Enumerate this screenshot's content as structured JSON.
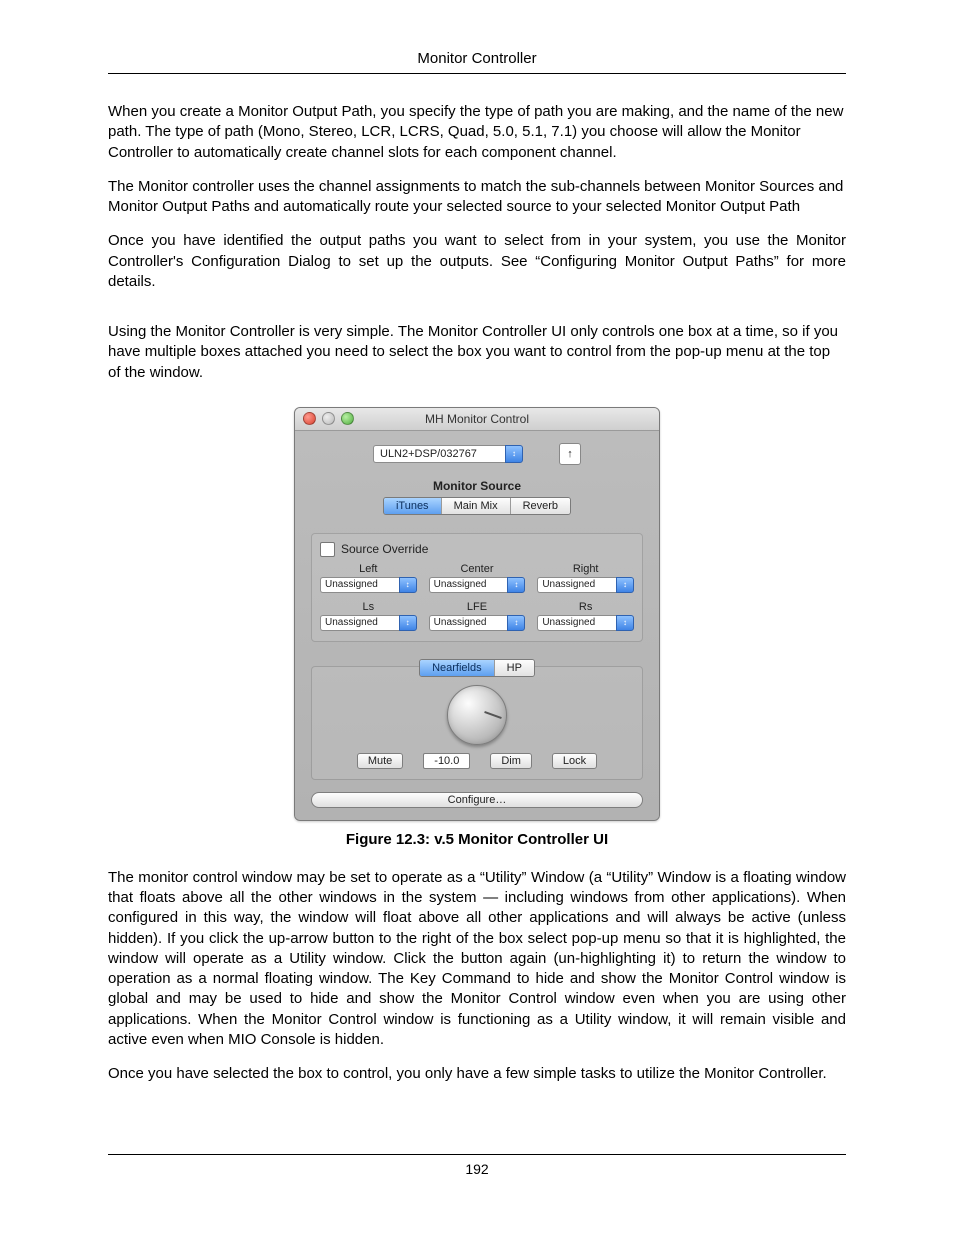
{
  "header": "Monitor Controller",
  "paragraphs": {
    "p1": "When you create a Monitor Output Path, you specify the type of path you are making, and the name of the new path. The type of path (Mono, Stereo, LCR, LCRS, Quad, 5.0, 5.1, 7.1) you choose will allow the Monitor Controller to automatically create channel slots for each component channel.",
    "p2": "The Monitor controller uses the channel assignments to match the sub-channels between Monitor Sources and Monitor Output Paths and automatically route your selected source to your selected Monitor Output Path",
    "p3": "Once you have identified the output paths you want to select from in your system, you use the Monitor Controller's Configuration Dialog to set up the outputs. See “Configuring Monitor Output Paths” for more details.",
    "p4": "Using the Monitor Controller is very simple. The Monitor Controller UI only controls one box at a time, so if you have multiple boxes attached you need to select the box you want to control from the pop-up menu at the top of the window.",
    "p5": "The monitor control window may be set to operate as a “Utility” Window (a “Utility” Window is a floating window that floats above all the other windows in the system — including windows from other applications). When configured in this way, the window will float above all other applications and will always be active (unless hidden). If you click the up-arrow button to the right of the box select pop-up menu so that it is highlighted, the window will operate as a Utility window. Click the button again (un-highlighting it) to return the window to operation as a normal floating window. The Key Command to hide and show the Monitor Control window is global and may be used to hide and show the Monitor Control window even when you are using other applications. When the Monitor Control window is functioning as a Utility window, it will remain visible and active even when MIO Console is hidden.",
    "p6": "Once you have selected the box to control, you only have a few simple tasks to utilize the Monitor Controller."
  },
  "caption": "Figure 12.3: v.5 Monitor Controller UI",
  "page_number": "192",
  "window": {
    "title": "MH Monitor Control",
    "box_select": "ULN2+DSP/032767",
    "up_arrow": "↑",
    "monitor_source_label": "Monitor Source",
    "sources": [
      "iTunes",
      "Main Mix",
      "Reverb"
    ],
    "active_source_index": 0,
    "override_label": "Source Override",
    "channels": [
      {
        "label": "Left",
        "value": "Unassigned"
      },
      {
        "label": "Center",
        "value": "Unassigned"
      },
      {
        "label": "Right",
        "value": "Unassigned"
      },
      {
        "label": "Ls",
        "value": "Unassigned"
      },
      {
        "label": "LFE",
        "value": "Unassigned"
      },
      {
        "label": "Rs",
        "value": "Unassigned"
      }
    ],
    "output_tabs": [
      "Nearfields",
      "HP"
    ],
    "active_output_index": 0,
    "mute_label": "Mute",
    "level_value": "-10.0",
    "dim_label": "Dim",
    "lock_label": "Lock",
    "configure_label": "Configure…",
    "select_arrows": "↕"
  }
}
